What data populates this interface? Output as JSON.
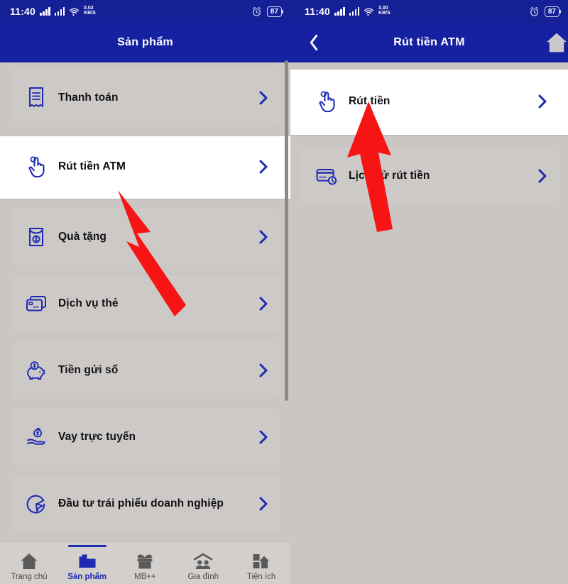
{
  "colors": {
    "brand_blue": "#1521a0",
    "status_blue": "#151f96",
    "icon_blue": "#1f2ab4",
    "page_bg": "#c9c6c4",
    "card_bg": "#ccc9c7",
    "highlight_bg": "#ffffff",
    "annotation_red": "#f71414",
    "nav_bg": "#d2cfcd"
  },
  "left_pane": {
    "status_bar": {
      "time": "11:40",
      "net_rate_value": "0.02",
      "net_rate_unit": "KB/S",
      "battery": "87",
      "alarm_icon": "alarm-clock-icon",
      "signal_icon": "signal-bars-icon",
      "wifi_icon": "wifi-icon"
    },
    "header": {
      "title": "Sản phẩm"
    },
    "items": [
      {
        "label": "Thanh toán",
        "icon": "receipt-icon",
        "selected": false,
        "chevron": "chevron-right-icon"
      },
      {
        "label": "Rút tiền ATM",
        "icon": "tap-hand-icon",
        "selected": true,
        "chevron": "chevron-right-icon"
      },
      {
        "label": "Quà tặng",
        "icon": "gift-money-icon",
        "selected": false,
        "chevron": "chevron-right-icon"
      },
      {
        "label": "Dịch vụ thẻ",
        "icon": "cards-icon",
        "selected": false,
        "chevron": "chevron-right-icon"
      },
      {
        "label": "Tiền gửi số",
        "icon": "piggy-bank-icon",
        "selected": false,
        "chevron": "chevron-right-icon"
      },
      {
        "label": "Vay trực tuyến",
        "icon": "hand-coin-icon",
        "selected": false,
        "chevron": "chevron-right-icon"
      },
      {
        "label": "Đầu tư trái phiếu doanh nghiệp",
        "icon": "bond-invest-icon",
        "selected": false,
        "chevron": "chevron-right-icon"
      }
    ],
    "bottom_nav": [
      {
        "label": "Trang chủ",
        "icon": "home-icon",
        "active": false
      },
      {
        "label": "Sản phẩm",
        "icon": "folder-icon",
        "active": true
      },
      {
        "label": "MB++",
        "icon": "gift-icon",
        "active": false
      },
      {
        "label": "Gia đình",
        "icon": "family-icon",
        "active": false
      },
      {
        "label": "Tiện ích",
        "icon": "grid-icon",
        "active": false
      }
    ]
  },
  "right_pane": {
    "status_bar": {
      "time": "11:40",
      "net_rate_value": "3.00",
      "net_rate_unit": "KB/S",
      "battery": "87",
      "alarm_icon": "alarm-clock-icon",
      "signal_icon": "signal-bars-icon",
      "wifi_icon": "wifi-icon"
    },
    "header": {
      "title": "Rút tiền ATM",
      "back_icon": "chevron-left-icon",
      "home_icon": "home-icon"
    },
    "items": [
      {
        "label": "Rút tiền",
        "icon": "tap-hand-icon",
        "selected": true,
        "chevron": "chevron-right-icon"
      },
      {
        "label": "Lịch sử rút tiền",
        "icon": "card-history-icon",
        "selected": false,
        "chevron": "chevron-right-icon"
      }
    ]
  },
  "annotations": [
    {
      "name": "arrow-to-rut-tien-atm",
      "color": "#f71414"
    },
    {
      "name": "arrow-to-rut-tien",
      "color": "#f71414"
    }
  ]
}
